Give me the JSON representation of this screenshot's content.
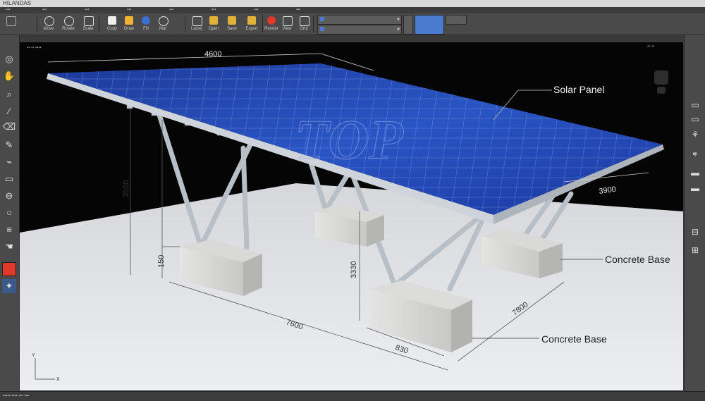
{
  "window": {
    "title": "HILANDAS"
  },
  "toolbar": {
    "buttons": [
      {
        "icon": "move-icon",
        "label": "Move"
      },
      {
        "icon": "rotate-icon",
        "label": "Rotate"
      },
      {
        "icon": "scale-icon",
        "label": "Scale"
      },
      {
        "icon": "copy-icon",
        "label": "Copy"
      },
      {
        "icon": "pen-icon",
        "label": "Draw"
      },
      {
        "icon": "fill-icon",
        "label": "Fill"
      },
      {
        "icon": "material-icon",
        "label": "Mat"
      },
      {
        "icon": "lasso-icon",
        "label": "Lasso"
      },
      {
        "icon": "folder-icon",
        "label": "Open"
      },
      {
        "icon": "folder-icon",
        "label": "Save"
      },
      {
        "icon": "folder-icon",
        "label": "Export"
      },
      {
        "icon": "folder-icon",
        "label": "Import"
      },
      {
        "icon": "record-icon",
        "label": "Render"
      },
      {
        "icon": "camera-icon",
        "label": "View"
      },
      {
        "icon": "grid-icon",
        "label": "Grid"
      }
    ]
  },
  "viewport": {
    "watermark": "TOP",
    "dimensions": {
      "top_length": "4600",
      "side_width": "3900",
      "height_left": "3500",
      "base_height": "150",
      "height_front": "3330",
      "bottom_length": "7600",
      "bottom_width": "7800",
      "base_width": "830"
    },
    "labels": {
      "solar_panel": "Solar Panel",
      "concrete_base_right": "Concrete Base",
      "concrete_base_front": "Concrete Base"
    },
    "axis": {
      "x": "X",
      "y": "Y"
    }
  },
  "colors": {
    "accent_red": "#e0392b",
    "accent_blue": "#4a7bd0"
  }
}
